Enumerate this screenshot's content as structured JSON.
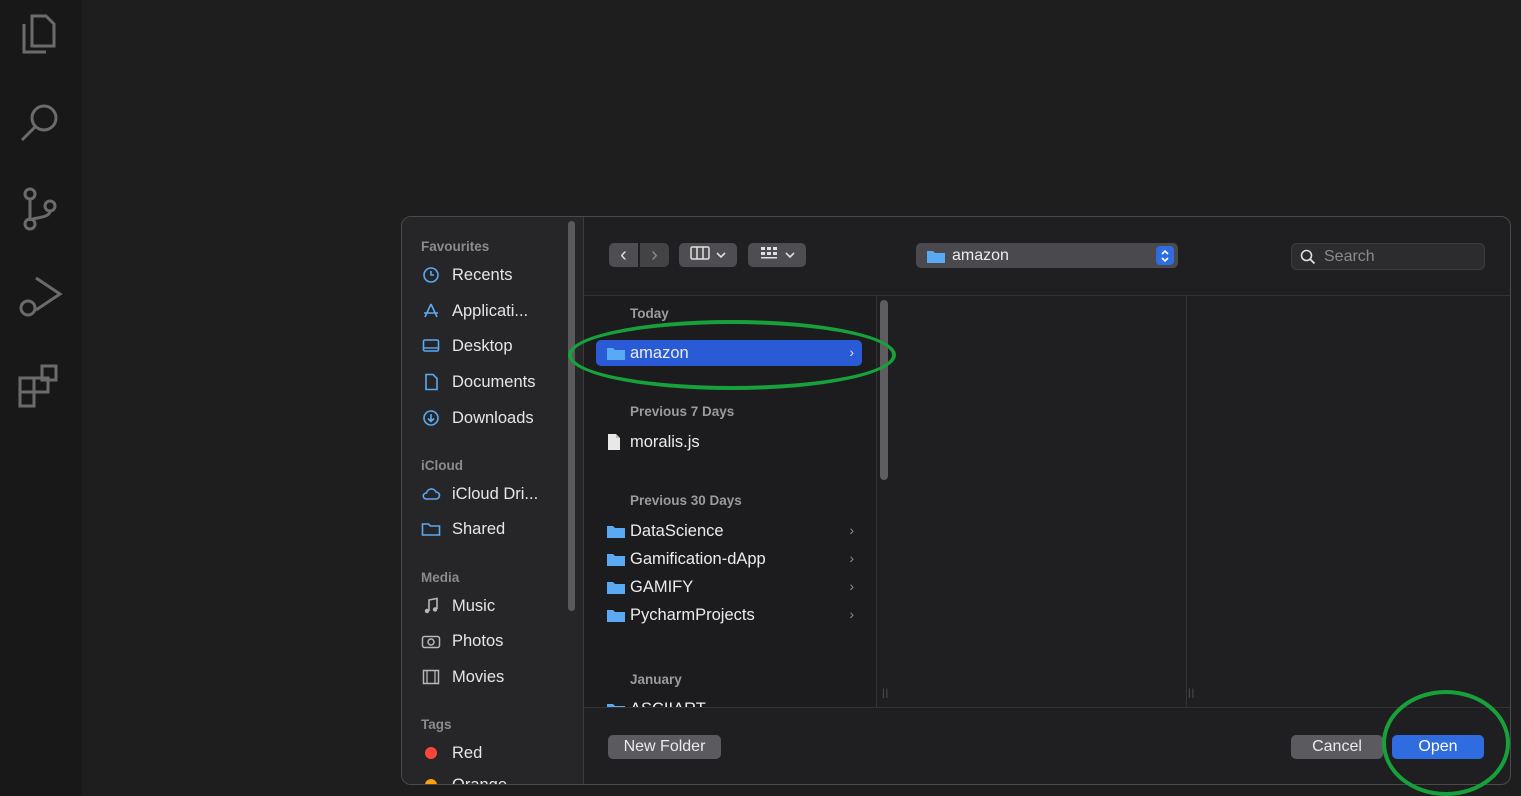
{
  "activity_bar": {
    "icons": [
      "explorer-icon",
      "search-icon",
      "source-control-icon",
      "run-debug-icon",
      "extensions-icon"
    ]
  },
  "dialog": {
    "sidebar": {
      "sections": [
        {
          "title": "Favourites",
          "items": [
            {
              "label": "Recents",
              "icon": "clock-icon"
            },
            {
              "label": "Applicati...",
              "icon": "applications-icon"
            },
            {
              "label": "Desktop",
              "icon": "desktop-icon"
            },
            {
              "label": "Documents",
              "icon": "document-icon"
            },
            {
              "label": "Downloads",
              "icon": "download-icon"
            }
          ]
        },
        {
          "title": "iCloud",
          "items": [
            {
              "label": "iCloud Dri...",
              "icon": "cloud-icon"
            },
            {
              "label": "Shared",
              "icon": "shared-folder-icon"
            }
          ]
        },
        {
          "title": "Media",
          "items": [
            {
              "label": "Music",
              "icon": "music-icon"
            },
            {
              "label": "Photos",
              "icon": "camera-icon"
            },
            {
              "label": "Movies",
              "icon": "film-icon"
            }
          ]
        },
        {
          "title": "Tags",
          "items": [
            {
              "label": "Red",
              "icon": "red-tag-icon",
              "color": "#ff453a"
            },
            {
              "label": "Orange",
              "icon": "orange-tag-icon",
              "color": "#ff9f0a"
            }
          ]
        }
      ]
    },
    "toolbar": {
      "back": "‹",
      "forward": "›",
      "current_folder": "amazon",
      "search_placeholder": "Search"
    },
    "browser": {
      "groups": [
        {
          "title": "Today",
          "items": [
            {
              "name": "amazon",
              "type": "folder",
              "selected": true
            }
          ]
        },
        {
          "title": "Previous 7 Days",
          "items": [
            {
              "name": "moralis.js",
              "type": "file"
            }
          ]
        },
        {
          "title": "Previous 30 Days",
          "items": [
            {
              "name": "DataScience",
              "type": "folder"
            },
            {
              "name": "Gamification-dApp",
              "type": "folder"
            },
            {
              "name": "GAMIFY",
              "type": "folder"
            },
            {
              "name": "PycharmProjects",
              "type": "folder"
            }
          ]
        },
        {
          "title": "January",
          "items": [
            {
              "name": "ASCIIART",
              "type": "folder"
            }
          ]
        }
      ]
    },
    "buttons": {
      "new_folder": "New Folder",
      "cancel": "Cancel",
      "open": "Open"
    }
  },
  "colors": {
    "accent": "#2f6cdf",
    "selection": "#2a5bd7",
    "annotation": "#17a13a",
    "folder": "#5aa9f3"
  }
}
